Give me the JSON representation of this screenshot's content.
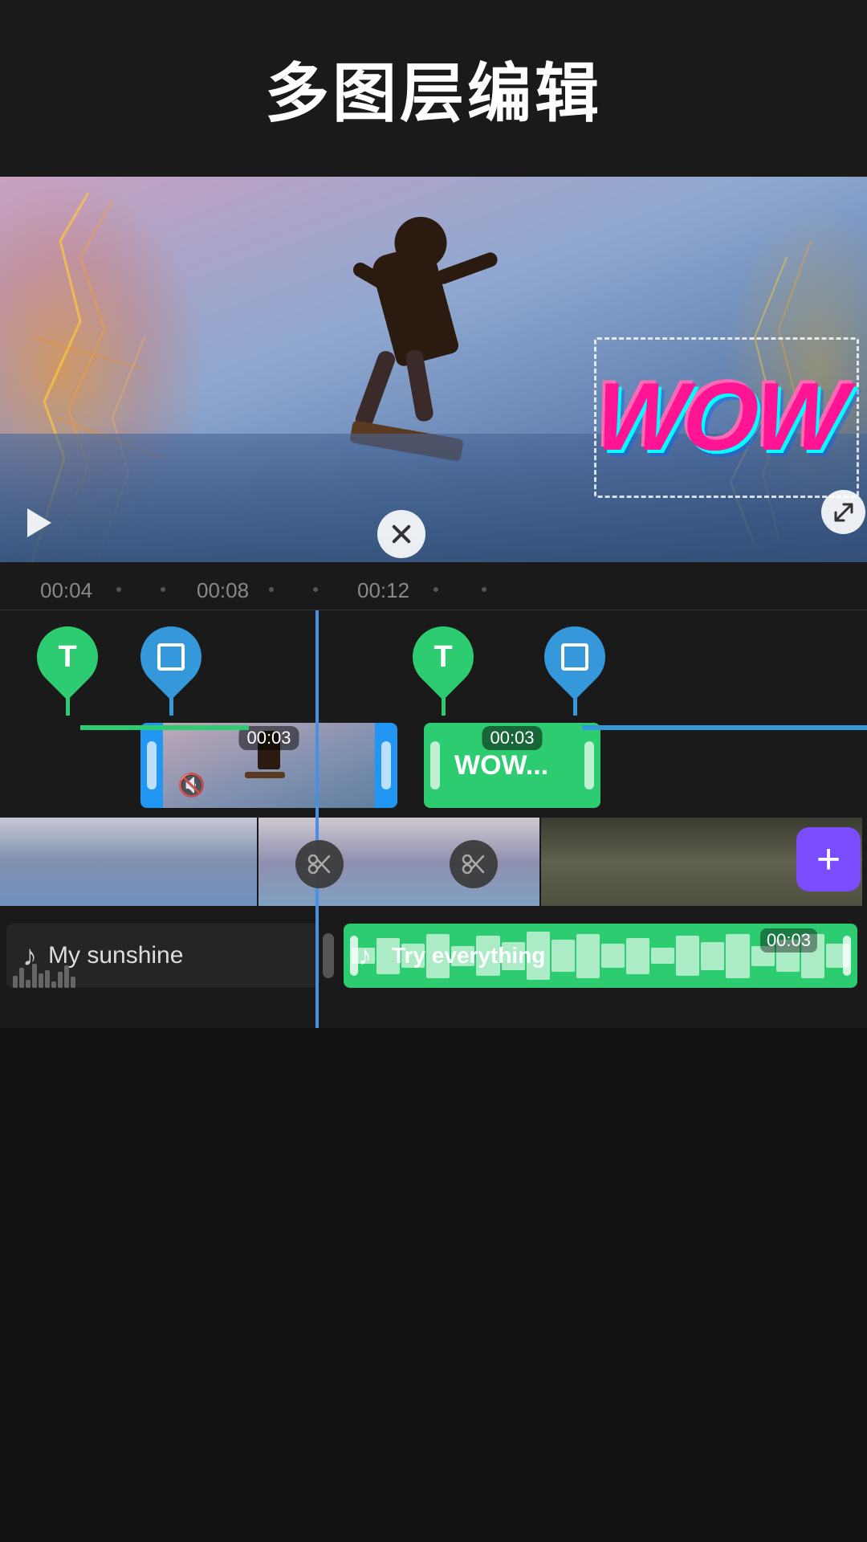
{
  "header": {
    "title": "多图层编辑"
  },
  "preview": {
    "wow_text": "WOW"
  },
  "timeline": {
    "times": [
      "00:04",
      "00:08",
      "00:12"
    ],
    "clip1": {
      "duration": "00:03",
      "label": "00:03"
    },
    "clip2": {
      "duration": "00:03",
      "label": "00:03",
      "text": "WOW..."
    },
    "audio_left": {
      "title": "My sunshine",
      "icon": "♪"
    },
    "audio_right": {
      "title": "Try everything",
      "duration": "00:03",
      "icon": "♪"
    }
  },
  "buttons": {
    "add_label": "+",
    "close_label": "×",
    "resize_label": "↗"
  }
}
